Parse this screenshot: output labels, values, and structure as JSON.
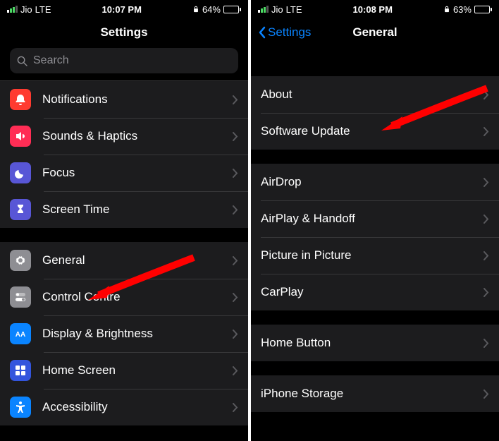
{
  "left": {
    "status": {
      "carrier": "Jio",
      "network": "LTE",
      "time": "10:07 PM",
      "battery": "64%"
    },
    "title": "Settings",
    "search_placeholder": "Search",
    "groups": [
      {
        "rows": [
          {
            "icon": "bell-icon",
            "bg": "#ff3b30",
            "label": "Notifications"
          },
          {
            "icon": "speaker-icon",
            "bg": "#ff2d55",
            "label": "Sounds & Haptics"
          },
          {
            "icon": "moon-icon",
            "bg": "#5856d6",
            "label": "Focus"
          },
          {
            "icon": "hourglass-icon",
            "bg": "#5856d6",
            "label": "Screen Time"
          }
        ]
      },
      {
        "rows": [
          {
            "icon": "gear-icon",
            "bg": "#8e8e93",
            "label": "General"
          },
          {
            "icon": "switches-icon",
            "bg": "#8e8e93",
            "label": "Control Centre"
          },
          {
            "icon": "aa-icon",
            "bg": "#0a84ff",
            "label": "Display & Brightness"
          },
          {
            "icon": "grid-icon",
            "bg": "#3355dd",
            "label": "Home Screen"
          },
          {
            "icon": "accessibility-icon",
            "bg": "#0a84ff",
            "label": "Accessibility"
          }
        ]
      }
    ]
  },
  "right": {
    "status": {
      "carrier": "Jio",
      "network": "LTE",
      "time": "10:08 PM",
      "battery": "63%"
    },
    "back": "Settings",
    "title": "General",
    "groups": [
      {
        "rows": [
          {
            "label": "About"
          },
          {
            "label": "Software Update"
          }
        ]
      },
      {
        "rows": [
          {
            "label": "AirDrop"
          },
          {
            "label": "AirPlay & Handoff"
          },
          {
            "label": "Picture in Picture"
          },
          {
            "label": "CarPlay"
          }
        ]
      },
      {
        "rows": [
          {
            "label": "Home Button"
          }
        ]
      },
      {
        "rows": [
          {
            "label": "iPhone Storage"
          }
        ]
      }
    ]
  }
}
